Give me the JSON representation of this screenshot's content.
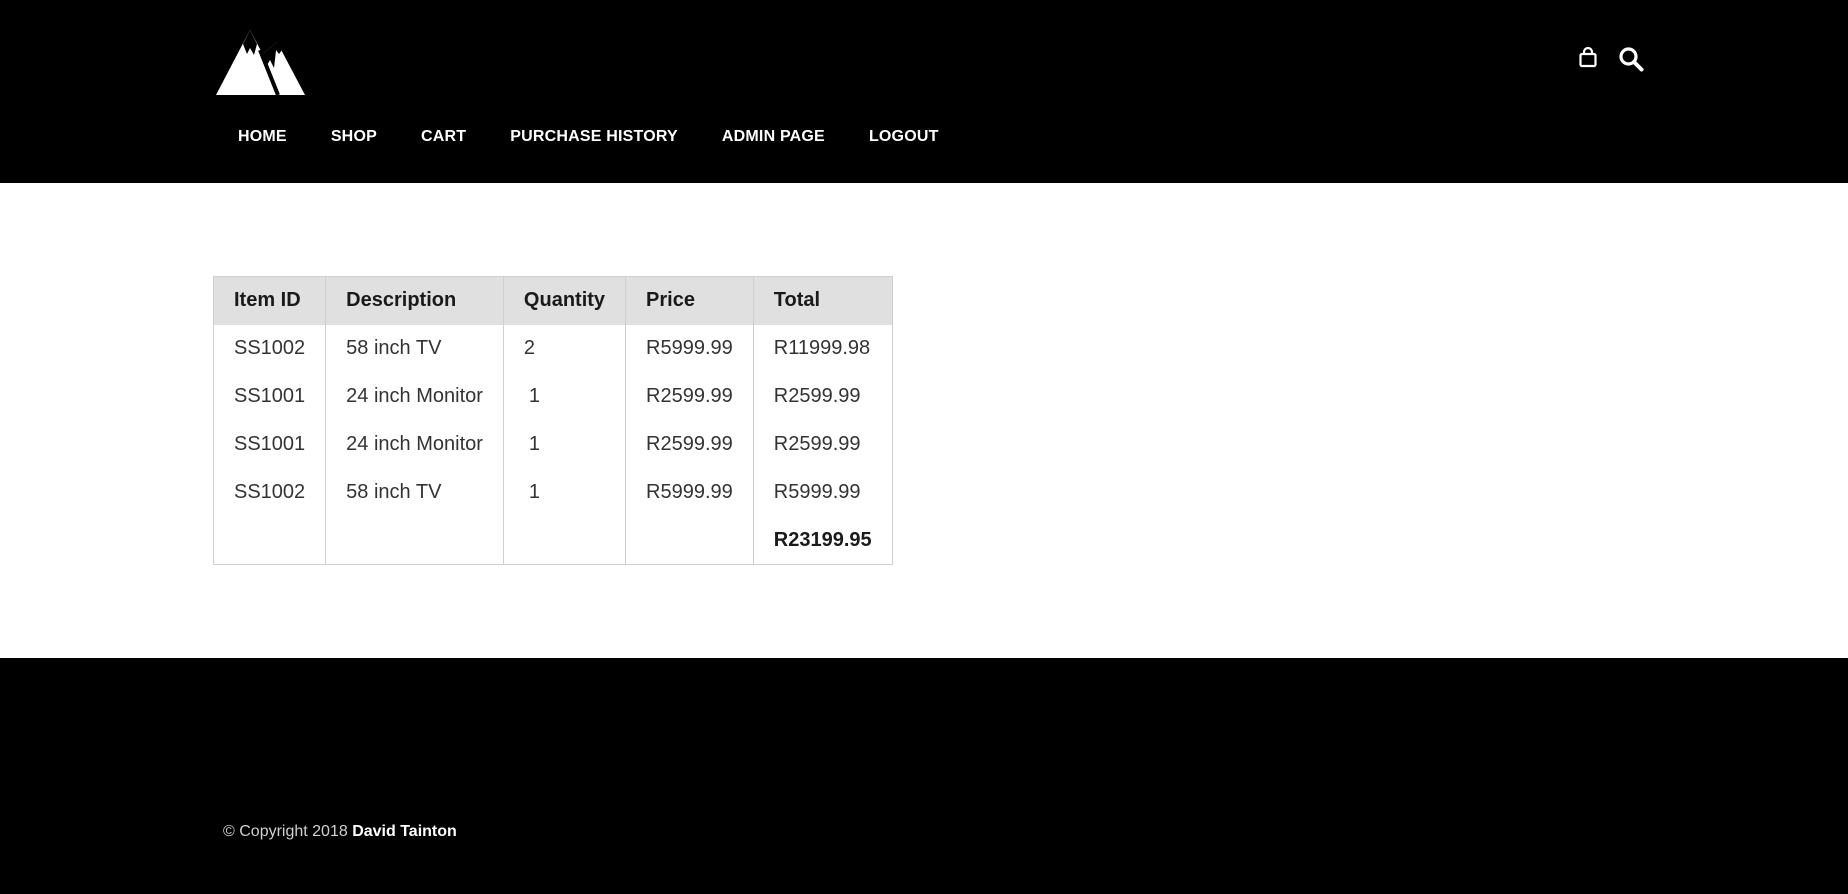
{
  "header": {
    "logo_icon": "mountains-logo-icon",
    "icons": [
      "shopping-bag-icon",
      "search-icon"
    ],
    "nav": [
      {
        "label": "HOME"
      },
      {
        "label": "SHOP"
      },
      {
        "label": "CART"
      },
      {
        "label": "PURCHASE HISTORY"
      },
      {
        "label": "ADMIN PAGE"
      },
      {
        "label": "LOGOUT"
      }
    ]
  },
  "cart": {
    "columns": [
      "Item ID",
      "Description",
      "Quantity",
      "Price",
      "Total"
    ],
    "rows": [
      {
        "id": "SS1002",
        "description": "58 inch TV",
        "quantity": "2",
        "price": "R5999.99",
        "total": "R11999.98"
      },
      {
        "id": "SS1001",
        "description": "24 inch Monitor",
        "quantity": "1",
        "price": "R2599.99",
        "total": "R2599.99"
      },
      {
        "id": "SS1001",
        "description": "24 inch Monitor",
        "quantity": "1",
        "price": "R2599.99",
        "total": "R2599.99"
      },
      {
        "id": "SS1002",
        "description": "58 inch TV",
        "quantity": "1",
        "price": "R5999.99",
        "total": "R5999.99"
      }
    ],
    "grand_total": "R23199.95"
  },
  "footer": {
    "copyright_prefix": "© Copyright 2018",
    "author": "David Tainton"
  },
  "colors": {
    "header_bg": "#000000",
    "table_header_bg": "#e0e0e0",
    "text": "#333333"
  }
}
